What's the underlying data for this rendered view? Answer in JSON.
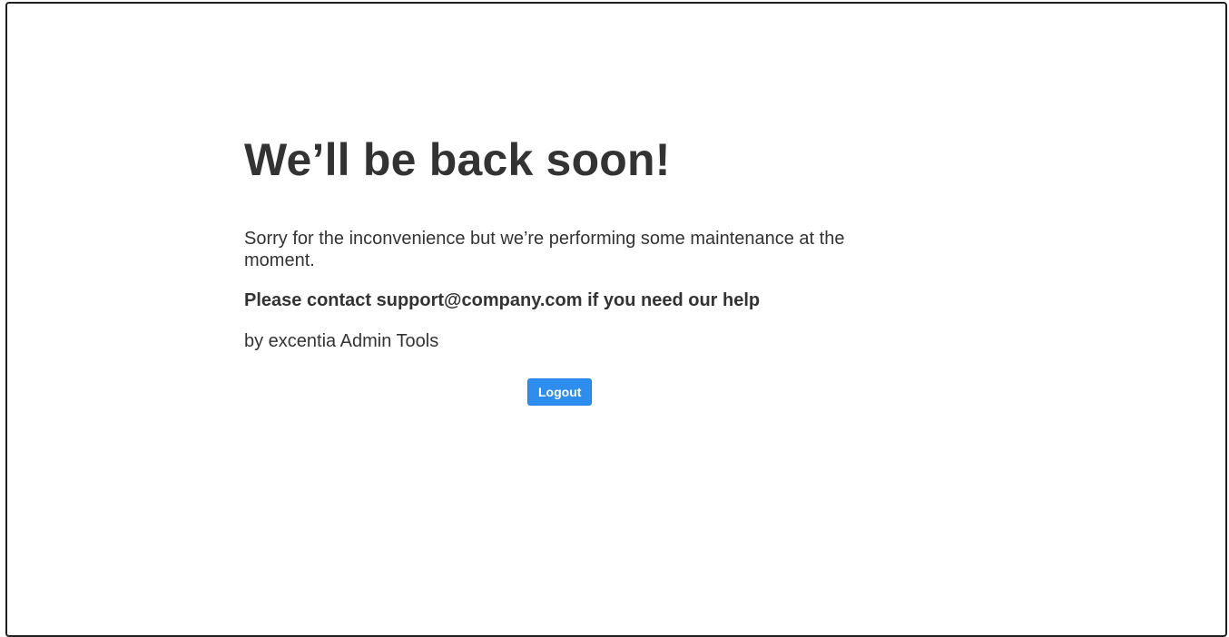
{
  "page": {
    "title": "We’ll be back soon!",
    "message": "Sorry for the inconvenience but we’re performing some maintenance at the moment.",
    "contact": "Please contact support@company.com if you need our help",
    "credit": "by excentia Admin Tools",
    "logout_label": "Logout"
  },
  "colors": {
    "text": "#333333",
    "button": "#2d8ef0",
    "button_text": "#ffffff",
    "border": "#1f1f1f",
    "background": "#ffffff"
  }
}
